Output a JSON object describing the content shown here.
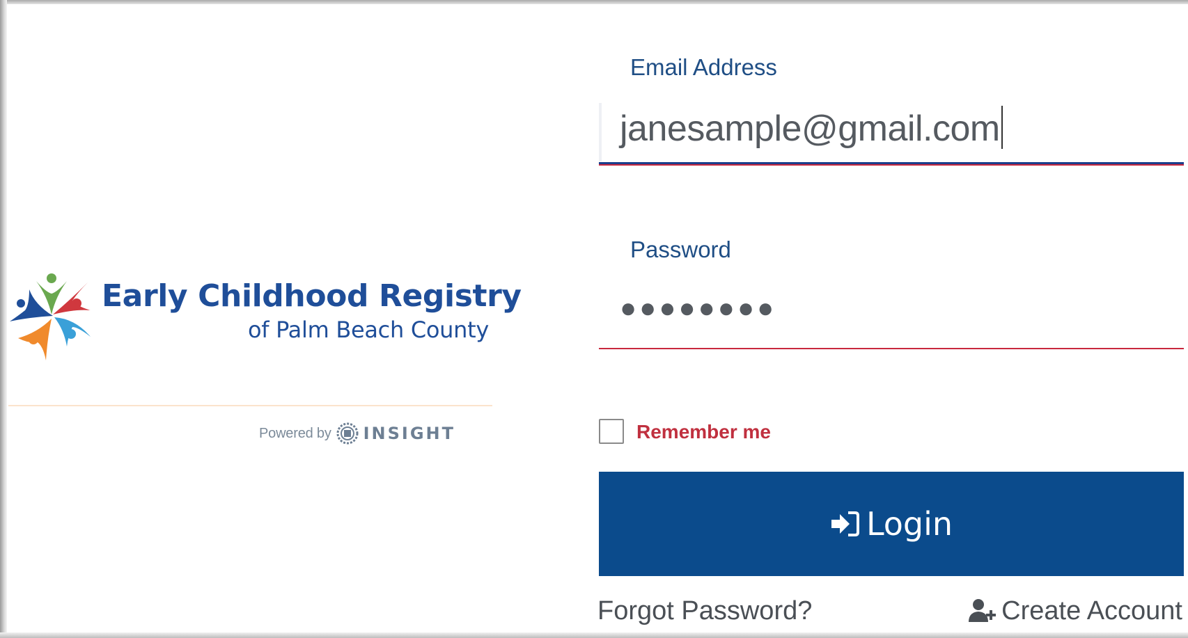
{
  "branding": {
    "title": "Early Childhood Registry",
    "subtitle": "of Palm Beach County",
    "powered_by": "Powered by",
    "powered_brand": "INSIGHT"
  },
  "form": {
    "email_label": "Email Address",
    "email_value": "janesample@gmail.com",
    "password_label": "Password",
    "password_masked": "●●●●●●●●",
    "remember_label": "Remember me",
    "remember_checked": false,
    "login_label": "Login",
    "forgot_label": "Forgot Password?",
    "create_label": "Create Account"
  },
  "colors": {
    "brand_blue": "#1f4e99",
    "button_blue": "#0b4b8c",
    "accent_red": "#c8283e",
    "link_gray": "#4a4f55"
  },
  "icons": {
    "login": "sign-in-icon",
    "create_account": "user-plus-icon",
    "logo": "registry-logo-icon",
    "insight": "insight-logo-icon"
  }
}
